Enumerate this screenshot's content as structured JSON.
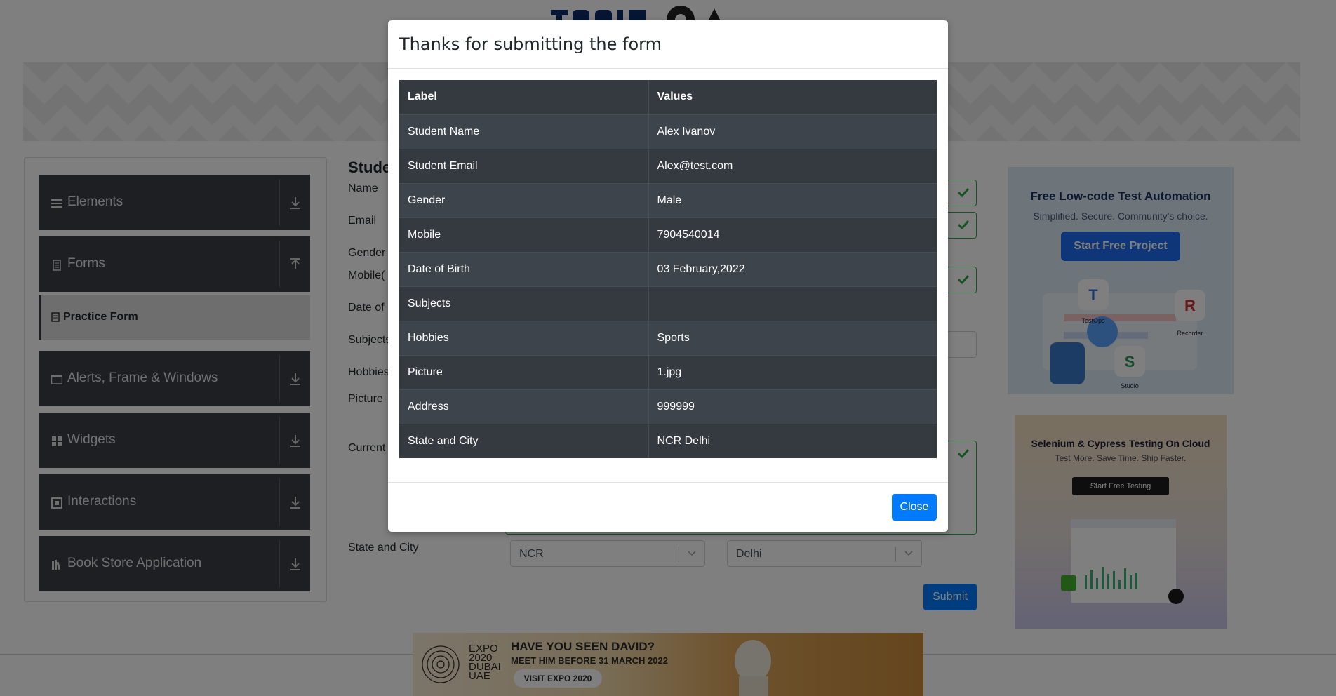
{
  "background": {
    "sidebar": {
      "groups": [
        {
          "label": "Elements",
          "icon": "menu-icon",
          "arrow": "download-arrow-icon"
        },
        {
          "label": "Forms",
          "icon": "document-icon",
          "arrow": "upload-arrow-icon"
        },
        {
          "label": "Alerts, Frame & Windows",
          "icon": "window-icon",
          "arrow": "download-arrow-icon"
        },
        {
          "label": "Widgets",
          "icon": "widgets-icon",
          "arrow": "download-arrow-icon"
        },
        {
          "label": "Interactions",
          "icon": "interactions-icon",
          "arrow": "download-arrow-icon"
        },
        {
          "label": "Book Store Application",
          "icon": "books-icon",
          "arrow": "download-arrow-icon"
        }
      ],
      "active_item": "Practice Form"
    },
    "form": {
      "title": "Studer",
      "labels": {
        "name": "Name",
        "email": "Email",
        "gender": "Gender",
        "mobile": "Mobile(",
        "dob": "Date of",
        "subjects": "Subjects",
        "hobbies": "Hobbies",
        "picture": "Picture",
        "current_address": "Current",
        "state_city": "State and City"
      },
      "state_value": "NCR",
      "city_value": "Delhi",
      "submit_label": "Submit"
    },
    "ads": {
      "ad1": {
        "title": "Free Low-code Test Automation",
        "subtitle": "Simplified. Secure. Community's choice.",
        "button": "Start Free Project",
        "tags": [
          "TestOps",
          "Recorder",
          "Studio"
        ]
      },
      "ad2": {
        "title": "Selenium & Cypress Testing On Cloud",
        "subtitle": "Test More. Save Time. Ship Faster.",
        "button": "Start Free Testing"
      },
      "expo": {
        "logo_lines": [
          "EXPO",
          "2020",
          "DUBAI",
          "UAE"
        ],
        "headline": "HAVE YOU SEEN DAVID?",
        "subline": "MEET HIM BEFORE 31 MARCH 2022",
        "button": "VISIT EXPO 2020"
      }
    }
  },
  "modal": {
    "title": "Thanks for submitting the form",
    "table": {
      "headers": [
        "Label",
        "Values"
      ],
      "rows": [
        [
          "Student Name",
          "Alex Ivanov"
        ],
        [
          "Student Email",
          "Alex@test.com"
        ],
        [
          "Gender",
          "Male"
        ],
        [
          "Mobile",
          "7904540014"
        ],
        [
          "Date of Birth",
          "03 February,2022"
        ],
        [
          "Subjects",
          ""
        ],
        [
          "Hobbies",
          "Sports"
        ],
        [
          "Picture",
          "1.jpg"
        ],
        [
          "Address",
          "999999"
        ],
        [
          "State and City",
          "NCR Delhi"
        ]
      ]
    },
    "close_label": "Close"
  }
}
